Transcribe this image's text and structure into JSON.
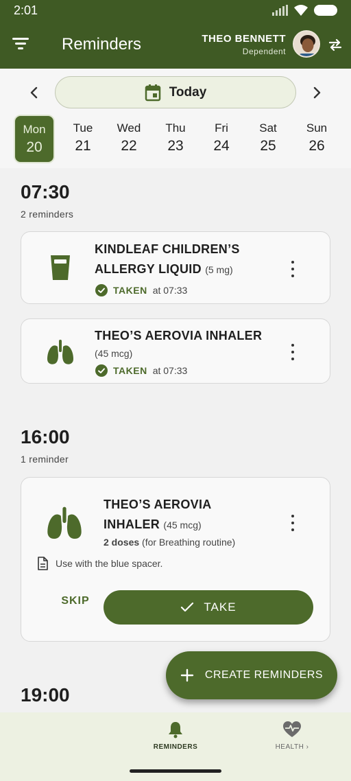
{
  "status_bar": {
    "time": "2:01"
  },
  "header": {
    "title": "Reminders",
    "profile_name": "THEO BENNETT",
    "profile_role": "Dependent"
  },
  "date_nav": {
    "today_label": "Today",
    "days": [
      {
        "name": "Mon",
        "num": "20",
        "selected": true
      },
      {
        "name": "Tue",
        "num": "21"
      },
      {
        "name": "Wed",
        "num": "22"
      },
      {
        "name": "Thu",
        "num": "23"
      },
      {
        "name": "Fri",
        "num": "24"
      },
      {
        "name": "Sat",
        "num": "25"
      },
      {
        "name": "Sun",
        "num": "26"
      }
    ]
  },
  "sections": [
    {
      "time": "07:30",
      "count": "2 reminders",
      "reminders": [
        {
          "name_line1": "KINDLEAF CHILDREN’S",
          "name_line2": "ALLERGY LIQUID",
          "dose": "(5 mg)",
          "status": "TAKEN",
          "status_time": "at 07:33",
          "icon": "cup-icon"
        },
        {
          "name_line1": "THEO’S AEROVIA INHALER",
          "dose": "(45 mcg)",
          "status": "TAKEN",
          "status_time": "at 07:33",
          "icon": "lungs-icon"
        }
      ]
    },
    {
      "time": "16:00",
      "count": "1 reminder",
      "reminders": [
        {
          "name_line1": "THEO’S AEROVIA",
          "name_line2": "INHALER",
          "dose": "(45 mcg)",
          "doses_bold": "2 doses",
          "doses_note": "(for Breathing routine)",
          "note": "Use with the blue spacer.",
          "skip_label": "SKIP",
          "take_label": "TAKE",
          "icon": "lungs-icon"
        }
      ]
    },
    {
      "time": "19:00"
    }
  ],
  "fab": {
    "label": "CREATE REMINDERS"
  },
  "bottom_nav": {
    "items": [
      {
        "label": "REMINDERS",
        "icon": "bell-icon",
        "active": true
      },
      {
        "label": "HEALTH",
        "icon": "heart-pulse-icon",
        "active": false
      }
    ]
  },
  "colors": {
    "primary": "#3f5a24",
    "accent": "#4d6a2b",
    "background": "#f1f1f1",
    "nav_background": "#edf1e2"
  }
}
